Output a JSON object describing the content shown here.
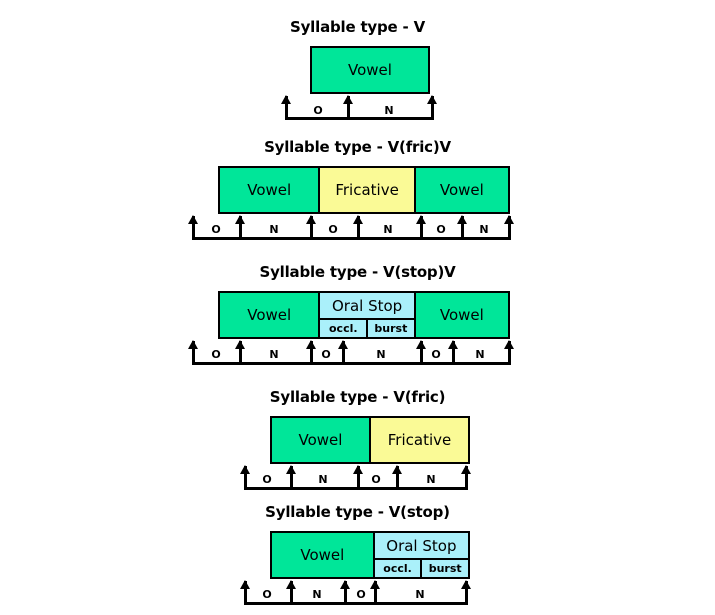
{
  "figure": {
    "caption_prefix": "Syllable type - ",
    "colors": {
      "vowel": "#00E699",
      "fricative": "#FAFA96",
      "oral_stop": "#AAF0FA",
      "outline": "#000000",
      "background": "#FFFFFF"
    }
  },
  "panels": [
    {
      "id": "v",
      "title": "Syllable type - V",
      "segments": [
        {
          "label": "Vowel",
          "color": "green",
          "type": "simple"
        }
      ],
      "tier": {
        "arrows": 3,
        "labels": [
          "O",
          "N"
        ]
      }
    },
    {
      "id": "v-fric-v",
      "title": "Syllable type - V(fric)V",
      "segments": [
        {
          "label": "Vowel",
          "color": "green",
          "type": "simple"
        },
        {
          "label": "Fricative",
          "color": "yellow",
          "type": "simple"
        },
        {
          "label": "Vowel",
          "color": "green",
          "type": "simple"
        }
      ],
      "tier": {
        "arrows": 7,
        "labels": [
          "O",
          "N",
          "O",
          "N",
          "O",
          "N"
        ]
      }
    },
    {
      "id": "v-stop-v",
      "title": "Syllable type - V(stop)V",
      "segments": [
        {
          "label": "Vowel",
          "color": "green",
          "type": "simple"
        },
        {
          "label": "Oral Stop",
          "color": "blue",
          "type": "split",
          "sub_labels": [
            "occl.",
            "burst"
          ]
        },
        {
          "label": "Vowel",
          "color": "green",
          "type": "simple"
        }
      ],
      "tier": {
        "arrows": 7,
        "labels": [
          "O",
          "N",
          "O",
          "N",
          "O",
          "N"
        ]
      }
    },
    {
      "id": "v-fric",
      "title": "Syllable type - V(fric)",
      "segments": [
        {
          "label": "Vowel",
          "color": "green",
          "type": "simple"
        },
        {
          "label": "Fricative",
          "color": "yellow",
          "type": "simple"
        }
      ],
      "tier": {
        "arrows": 5,
        "labels": [
          "O",
          "N",
          "O",
          "N"
        ]
      }
    },
    {
      "id": "v-stop",
      "title": "Syllable type - V(stop)",
      "segments": [
        {
          "label": "Vowel",
          "color": "green",
          "type": "simple"
        },
        {
          "label": "Oral Stop",
          "color": "blue",
          "type": "split",
          "sub_labels": [
            "occl.",
            "burst"
          ]
        }
      ],
      "tier": {
        "arrows": 5,
        "labels": [
          "O",
          "N",
          "O",
          "N"
        ]
      }
    }
  ]
}
